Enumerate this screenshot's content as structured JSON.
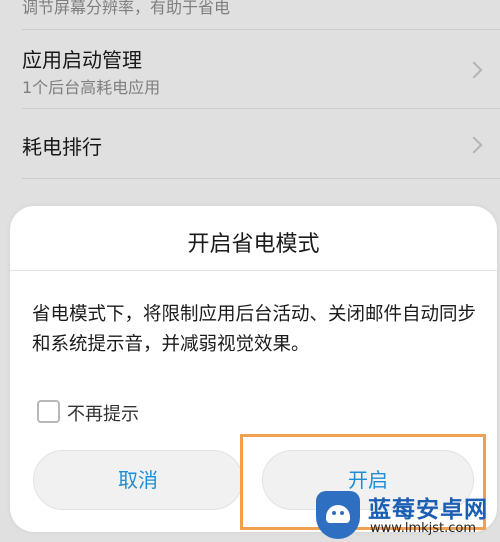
{
  "settings": {
    "top_subtitle": "调节屏幕分辨率，有助于省电",
    "items": [
      {
        "title": "应用启动管理",
        "subtitle": "1个后台高耗电应用"
      },
      {
        "title": "耗电排行"
      }
    ]
  },
  "dialog": {
    "title": "开启省电模式",
    "message": "省电模式下，将限制应用后台活动、关闭邮件自动同步和系统提示音，并减弱视觉效果。",
    "checkbox_label": "不再提示",
    "checkbox_checked": false,
    "cancel_label": "取消",
    "confirm_label": "开启",
    "button_text_color": "#1a8fd8",
    "highlight_color": "#f0a050"
  },
  "watermark": {
    "brand": "蓝莓安卓网",
    "url": "www.lmkjst.com"
  }
}
